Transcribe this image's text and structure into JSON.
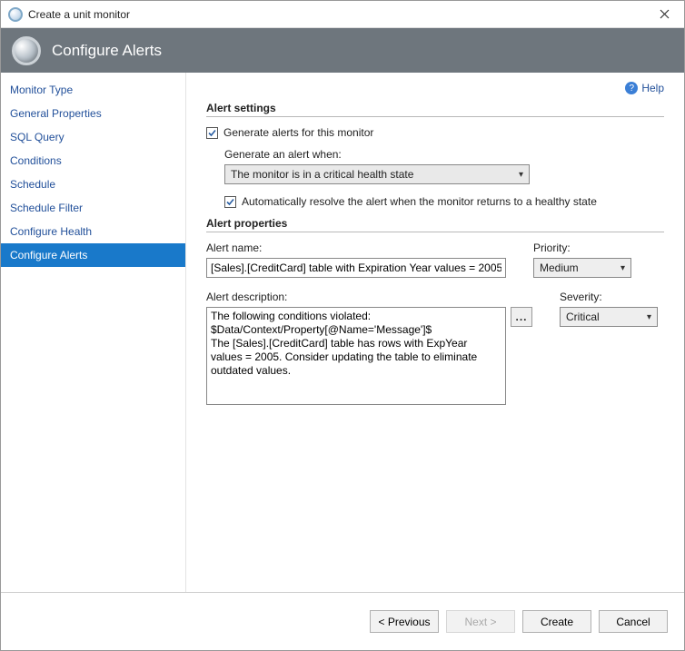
{
  "window": {
    "title": "Create a unit monitor"
  },
  "banner": {
    "heading": "Configure Alerts"
  },
  "sidebar": {
    "items": [
      {
        "label": "Monitor Type"
      },
      {
        "label": "General Properties"
      },
      {
        "label": "SQL Query"
      },
      {
        "label": "Conditions"
      },
      {
        "label": "Schedule"
      },
      {
        "label": "Schedule Filter"
      },
      {
        "label": "Configure Health"
      },
      {
        "label": "Configure Alerts"
      }
    ],
    "selectedIndex": 7
  },
  "help": {
    "label": "Help"
  },
  "settings": {
    "section_label": "Alert settings",
    "generate_label": "Generate alerts for this monitor",
    "generate_checked": true,
    "when_label": "Generate an alert when:",
    "when_value": "The monitor is in a critical health state",
    "auto_resolve_label": "Automatically resolve the alert when the monitor returns to a healthy state",
    "auto_resolve_checked": true
  },
  "properties": {
    "section_label": "Alert properties",
    "name_label": "Alert name:",
    "name_value": "[Sales].[CreditCard] table with Expiration Year values = 2005",
    "description_label": "Alert description:",
    "description_value": "The following conditions violated:\n$Data/Context/Property[@Name='Message']$\nThe [Sales].[CreditCard] table has rows with ExpYear values = 2005. Consider updating the table to eliminate outdated values.",
    "priority_label": "Priority:",
    "priority_value": "Medium",
    "severity_label": "Severity:",
    "severity_value": "Critical"
  },
  "footer": {
    "previous": "< Previous",
    "next": "Next >",
    "create": "Create",
    "cancel": "Cancel"
  }
}
